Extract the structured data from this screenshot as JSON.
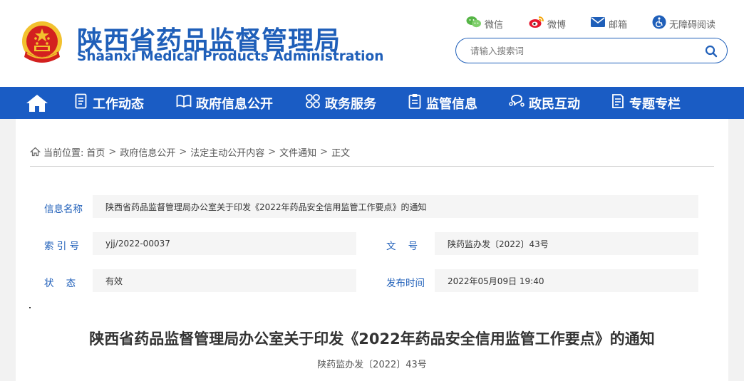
{
  "site": {
    "title_cn": "陕西省药品监督管理局",
    "title_en": "Shaanxi Medical Products Administration"
  },
  "toplinks": [
    {
      "label": "微信",
      "icon": "wechat-icon"
    },
    {
      "label": "微博",
      "icon": "weibo-icon"
    },
    {
      "label": "邮箱",
      "icon": "mail-icon"
    },
    {
      "label": "无障碍阅读",
      "icon": "accessibility-icon"
    }
  ],
  "search": {
    "placeholder": "请输入搜索词"
  },
  "nav": {
    "home_icon": "home-icon",
    "items": [
      {
        "label": "工作动态",
        "icon": "document-list-icon"
      },
      {
        "label": "政府信息公开",
        "icon": "book-icon"
      },
      {
        "label": "政务服务",
        "icon": "grid-icon"
      },
      {
        "label": "监管信息",
        "icon": "clipboard-icon"
      },
      {
        "label": "政民互动",
        "icon": "chat-icon"
      },
      {
        "label": "专题专栏",
        "icon": "notes-icon"
      }
    ]
  },
  "breadcrumb": {
    "prefix": "当前位置:",
    "items": [
      "首页",
      "政府信息公开",
      "法定主动公开内容",
      "文件通知",
      "正文"
    ],
    "separator": ">"
  },
  "info": {
    "name_label": "信息名称",
    "name_value": "陕西省药品监督管理局办公室关于印发《2022年药品安全信用监管工作要点》的通知",
    "index_label": "索 引 号",
    "index_value": "yjj/2022-00037",
    "docno_label": "文    号",
    "docno_value": "陕药监办发〔2022〕43号",
    "status_label": "状    态",
    "status_value": "有效",
    "date_label": "发布时间",
    "date_value": "2022年05月09日 19:40"
  },
  "article": {
    "title": "陕西省药品监督管理局办公室关于印发《2022年药品安全信用监管工作要点》的通知",
    "doc_number": "陕药监办发〔2022〕43号"
  },
  "colors": {
    "brand_blue": "#1f5fb9",
    "nav_blue": "#1a5cc4",
    "emblem_red": "#d3201f",
    "emblem_gold": "#f2c12e"
  }
}
